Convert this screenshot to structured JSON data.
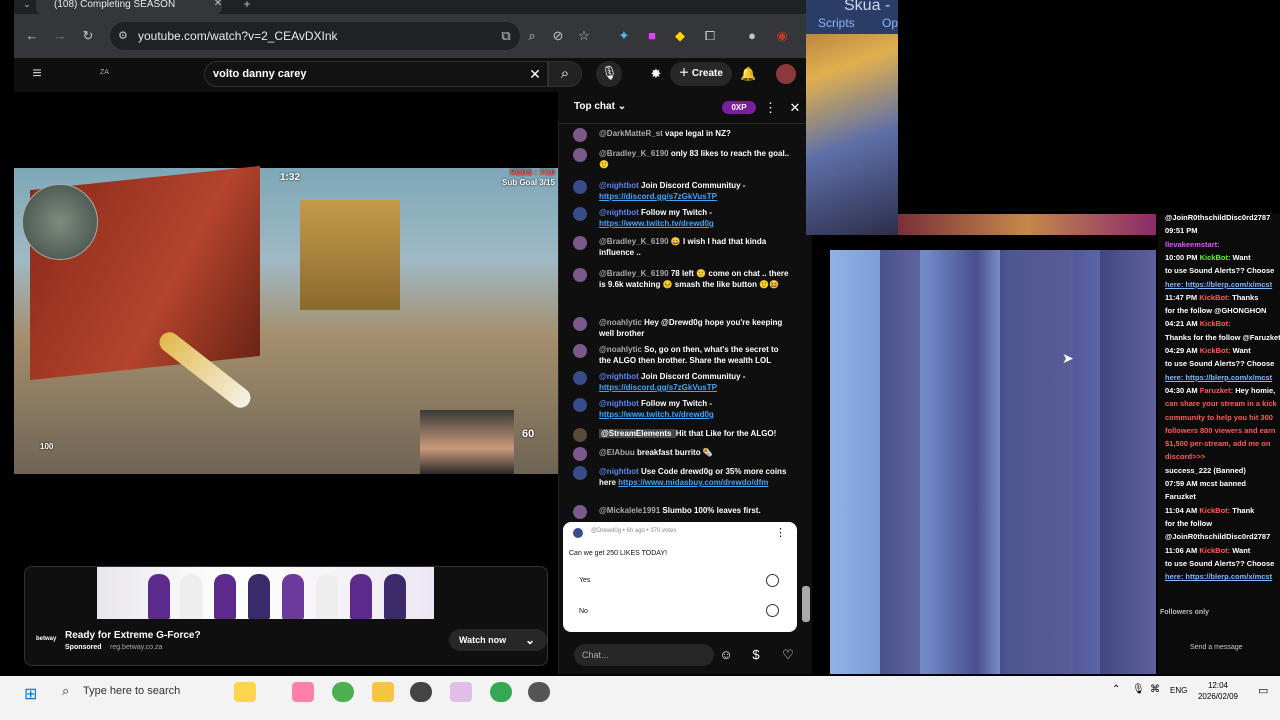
{
  "browser": {
    "tab_title": "(108) Completing SEASON",
    "url": "youtube.com/watch?v=2_CEAvDXInk"
  },
  "youtube": {
    "country": "ZA",
    "search_query": "volto danny carey",
    "create_label": "Create"
  },
  "video_hud": {
    "round_time": "1:32",
    "score_text": "REDS : 7/10",
    "sub_goal": "Sub Goal 3/15",
    "ammo": "60",
    "health": "100"
  },
  "ad": {
    "title": "Ready for Extreme G-Force?",
    "sponsored": "Sponsored",
    "domain": "reg.betway.co.za",
    "cta": "Watch now",
    "brand": "betway"
  },
  "chat": {
    "header": "Top chat",
    "xp": "0XP",
    "messages": [
      {
        "author": "@DarkMatteR_st",
        "text": "vape legal in NZ?",
        "kind": "user"
      },
      {
        "author": "@Bradley_K_6190",
        "text": "only 83 likes to reach the goal.. 🙂",
        "kind": "user"
      },
      {
        "author": "@nightbot",
        "text": "Join Discord Communituy - ",
        "link": "https://discord.gg/s7zGkVusTP",
        "kind": "bot"
      },
      {
        "author": "@nightbot",
        "text": "Follow my Twitch - ",
        "link": "https://www.twitch.tv/drewd0g",
        "kind": "bot"
      },
      {
        "author": "@Bradley_K_6190",
        "text": "😀 I wish I had that kinda influence ..",
        "kind": "user"
      },
      {
        "author": "@Bradley_K_6190",
        "text": "78 left 🙂 come on chat .. there is 9.6k watching 😣 smash the like button 🙂😆",
        "kind": "user"
      },
      {
        "author": "@noahlytic",
        "text": "Hey @Drewd0g hope you're keeping well brother",
        "kind": "user"
      },
      {
        "author": "@noahlytic",
        "text": "So, go on then, what's the secret to the ALGO then brother. Share the wealth LOL",
        "kind": "user"
      },
      {
        "author": "@nightbot",
        "text": "Join Discord Communituy - ",
        "link": "https://discord.gg/s7zGkVusTP",
        "kind": "bot"
      },
      {
        "author": "@nightbot",
        "text": "Follow my Twitch - ",
        "link": "https://www.twitch.tv/drewd0g",
        "kind": "bot"
      },
      {
        "author": "@StreamElements",
        "text": "Hit that Like for the ALGO!",
        "kind": "badge"
      },
      {
        "author": "@ElAbuu",
        "text": "breakfast burrito 🌯",
        "kind": "user"
      },
      {
        "author": "@nightbot",
        "text": "Use Code drewd0g or 35% more coins here ",
        "link": "https://www.midasbuy.com/drewdo/dfm",
        "kind": "bot"
      },
      {
        "author": "@Mickalele1991",
        "text": "Slumbo 100% leaves first.",
        "kind": "user"
      }
    ],
    "poll": {
      "meta": "@Drewd0g • 6h ago • 370 votes",
      "question": "Can we get 250 LIKES TODAY!",
      "options": [
        "Yes",
        "No"
      ]
    },
    "input_placeholder": "Chat..."
  },
  "side": {
    "window_title": "Skua -",
    "menu": [
      "Scripts",
      "Op"
    ]
  },
  "kick_chat": [
    {
      "time": "",
      "user": "",
      "text": "@JoinR0thschildDisc0rd2787",
      "cls": "t"
    },
    {
      "time": "09:51 PM",
      "user": "",
      "text": "",
      "cls": "t"
    },
    {
      "time": "",
      "user": "llevakeemstart:",
      "text": "",
      "cls": "pk"
    },
    {
      "time": "10:00 PM",
      "user": "KickBot:",
      "text": "Want",
      "cls": "u"
    },
    {
      "time": "",
      "user": "",
      "text": "to use Sound Alerts?? Choose",
      "cls": "t"
    },
    {
      "time": "",
      "user": "",
      "text": "here: https://blerp.com/x/mcst",
      "cls": "l"
    },
    {
      "time": "11:47 PM",
      "user": "KickBot:",
      "text": "Thanks",
      "cls": "r"
    },
    {
      "time": "",
      "user": "",
      "text": "for the follow @GHONGHON",
      "cls": "t"
    },
    {
      "time": "04:21 AM",
      "user": "KickBot:",
      "text": "",
      "cls": "r"
    },
    {
      "time": "",
      "user": "",
      "text": "Thanks for the follow @Faruzket",
      "cls": "t"
    },
    {
      "time": "04:29 AM",
      "user": "KickBot:",
      "text": "Want",
      "cls": "r"
    },
    {
      "time": "",
      "user": "",
      "text": "to use Sound Alerts?? Choose",
      "cls": "t"
    },
    {
      "time": "",
      "user": "",
      "text": "here: https://blerp.com/x/mcst",
      "cls": "l"
    },
    {
      "time": "04:30 AM",
      "user": "Faruzket:",
      "text": "Hey homie,",
      "cls": "r"
    },
    {
      "time": "",
      "user": "",
      "text": "can share your stream in a kick",
      "cls": "r"
    },
    {
      "time": "",
      "user": "",
      "text": "community to help you hit 300",
      "cls": "r"
    },
    {
      "time": "",
      "user": "",
      "text": "followers 800 viewers and earn",
      "cls": "r"
    },
    {
      "time": "",
      "user": "",
      "text": "$1,500 per-stream, add me on",
      "cls": "r"
    },
    {
      "time": "",
      "user": "",
      "text": "discord>>>",
      "cls": "r"
    },
    {
      "time": "",
      "user": "",
      "text": "success_222 (Banned)",
      "cls": "t"
    },
    {
      "time": "07:59 AM",
      "user": "",
      "text": "mcst banned",
      "cls": "t"
    },
    {
      "time": "",
      "user": "",
      "text": "Faruzket",
      "cls": "t"
    },
    {
      "time": "11:04 AM",
      "user": "KickBot:",
      "text": "Thank",
      "cls": "r"
    },
    {
      "time": "",
      "user": "",
      "text": "for the follow",
      "cls": "t"
    },
    {
      "time": "",
      "user": "",
      "text": "@JoinR0thschildDisc0rd2787",
      "cls": "t"
    },
    {
      "time": "11:06 AM",
      "user": "KickBot:",
      "text": "Want",
      "cls": "r"
    },
    {
      "time": "",
      "user": "",
      "text": "to use Sound Alerts?? Choose",
      "cls": "t"
    },
    {
      "time": "",
      "user": "",
      "text": "here: https://blerp.com/x/mcst",
      "cls": "l"
    }
  ],
  "kick_footer": {
    "followers_only": "Followers only",
    "send": "Send a message"
  },
  "taskbar": {
    "search_placeholder": "Type here to search",
    "lang": "ENG",
    "time": "12:04",
    "date": "2026/02/09"
  }
}
